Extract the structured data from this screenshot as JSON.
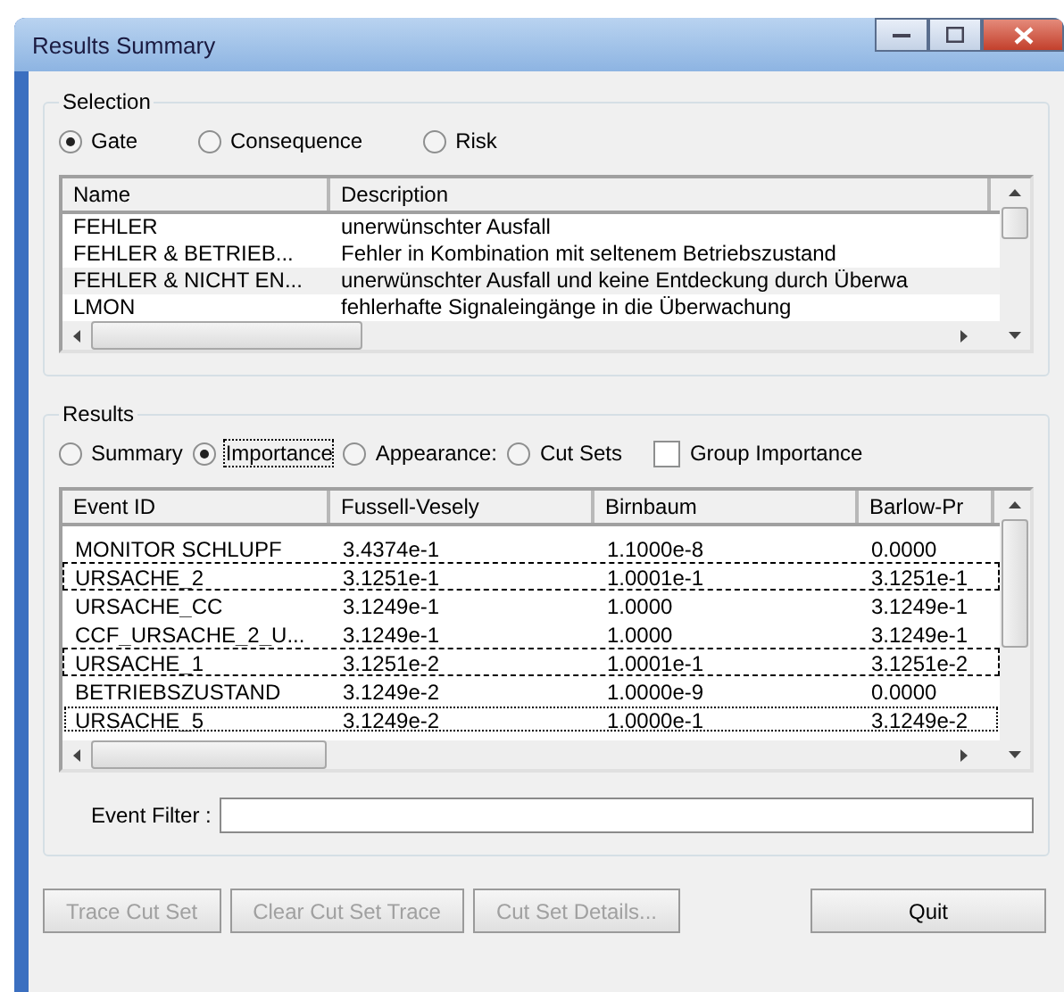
{
  "window": {
    "title": "Results Summary"
  },
  "selection": {
    "title": "Selection",
    "options": [
      {
        "label": "Gate",
        "selected": true
      },
      {
        "label": "Consequence",
        "selected": false
      },
      {
        "label": "Risk",
        "selected": false
      }
    ],
    "columns": [
      "Name",
      "Description"
    ],
    "rows": [
      {
        "cells": [
          "FEHLER",
          "unerwünschter Ausfall"
        ],
        "selected": false
      },
      {
        "cells": [
          "FEHLER & BETRIEB...",
          "Fehler in Kombination mit seltenem Betriebszustand"
        ],
        "selected": false
      },
      {
        "cells": [
          "FEHLER & NICHT EN...",
          "unerwünschter Ausfall und keine Entdeckung durch Überwa"
        ],
        "selected": true
      },
      {
        "cells": [
          "LMON",
          "fehlerhafte Signaleingänge in die Überwachung"
        ],
        "selected": false
      }
    ]
  },
  "results": {
    "title": "Results",
    "options": [
      {
        "label": "Summary",
        "selected": false
      },
      {
        "label": "Importance",
        "selected": true
      },
      {
        "label": "Appearance:",
        "selected": false
      },
      {
        "label": "Cut Sets",
        "selected": false
      }
    ],
    "group_importance": {
      "label": "Group Importance",
      "checked": false
    },
    "columns": [
      "Event ID",
      "Fussell-Vesely",
      "Birnbaum",
      "Barlow-Pr"
    ],
    "rows": [
      {
        "cells": [
          "MONITOR SCHLUPF",
          "3.4374e-1",
          "1.1000e-8",
          "0.0000"
        ],
        "marked": false,
        "focused": false
      },
      {
        "cells": [
          "URSACHE_2",
          "3.1251e-1",
          "1.0001e-1",
          "3.1251e-1"
        ],
        "marked": true,
        "focused": false
      },
      {
        "cells": [
          "URSACHE_CC",
          "3.1249e-1",
          "1.0000",
          "3.1249e-1"
        ],
        "marked": false,
        "focused": false
      },
      {
        "cells": [
          "CCF_URSACHE_2_U...",
          "3.1249e-1",
          "1.0000",
          "3.1249e-1"
        ],
        "marked": false,
        "focused": false
      },
      {
        "cells": [
          "URSACHE_1",
          "3.1251e-2",
          "1.0001e-1",
          "3.1251e-2"
        ],
        "marked": true,
        "focused": false
      },
      {
        "cells": [
          "BETRIEBSZUSTAND",
          "3.1249e-2",
          "1.0000e-9",
          "0.0000"
        ],
        "marked": false,
        "focused": false
      },
      {
        "cells": [
          "URSACHE_5",
          "3.1249e-2",
          "1.0000e-1",
          "3.1249e-2"
        ],
        "marked": false,
        "focused": true
      }
    ],
    "event_filter": {
      "label": "Event Filter :"
    }
  },
  "buttons": [
    {
      "label": "Trace Cut Set",
      "disabled": true
    },
    {
      "label": "Clear Cut Set Trace",
      "disabled": true
    },
    {
      "label": "Cut Set Details...",
      "disabled": true
    },
    {
      "label": "Quit",
      "disabled": false
    }
  ]
}
